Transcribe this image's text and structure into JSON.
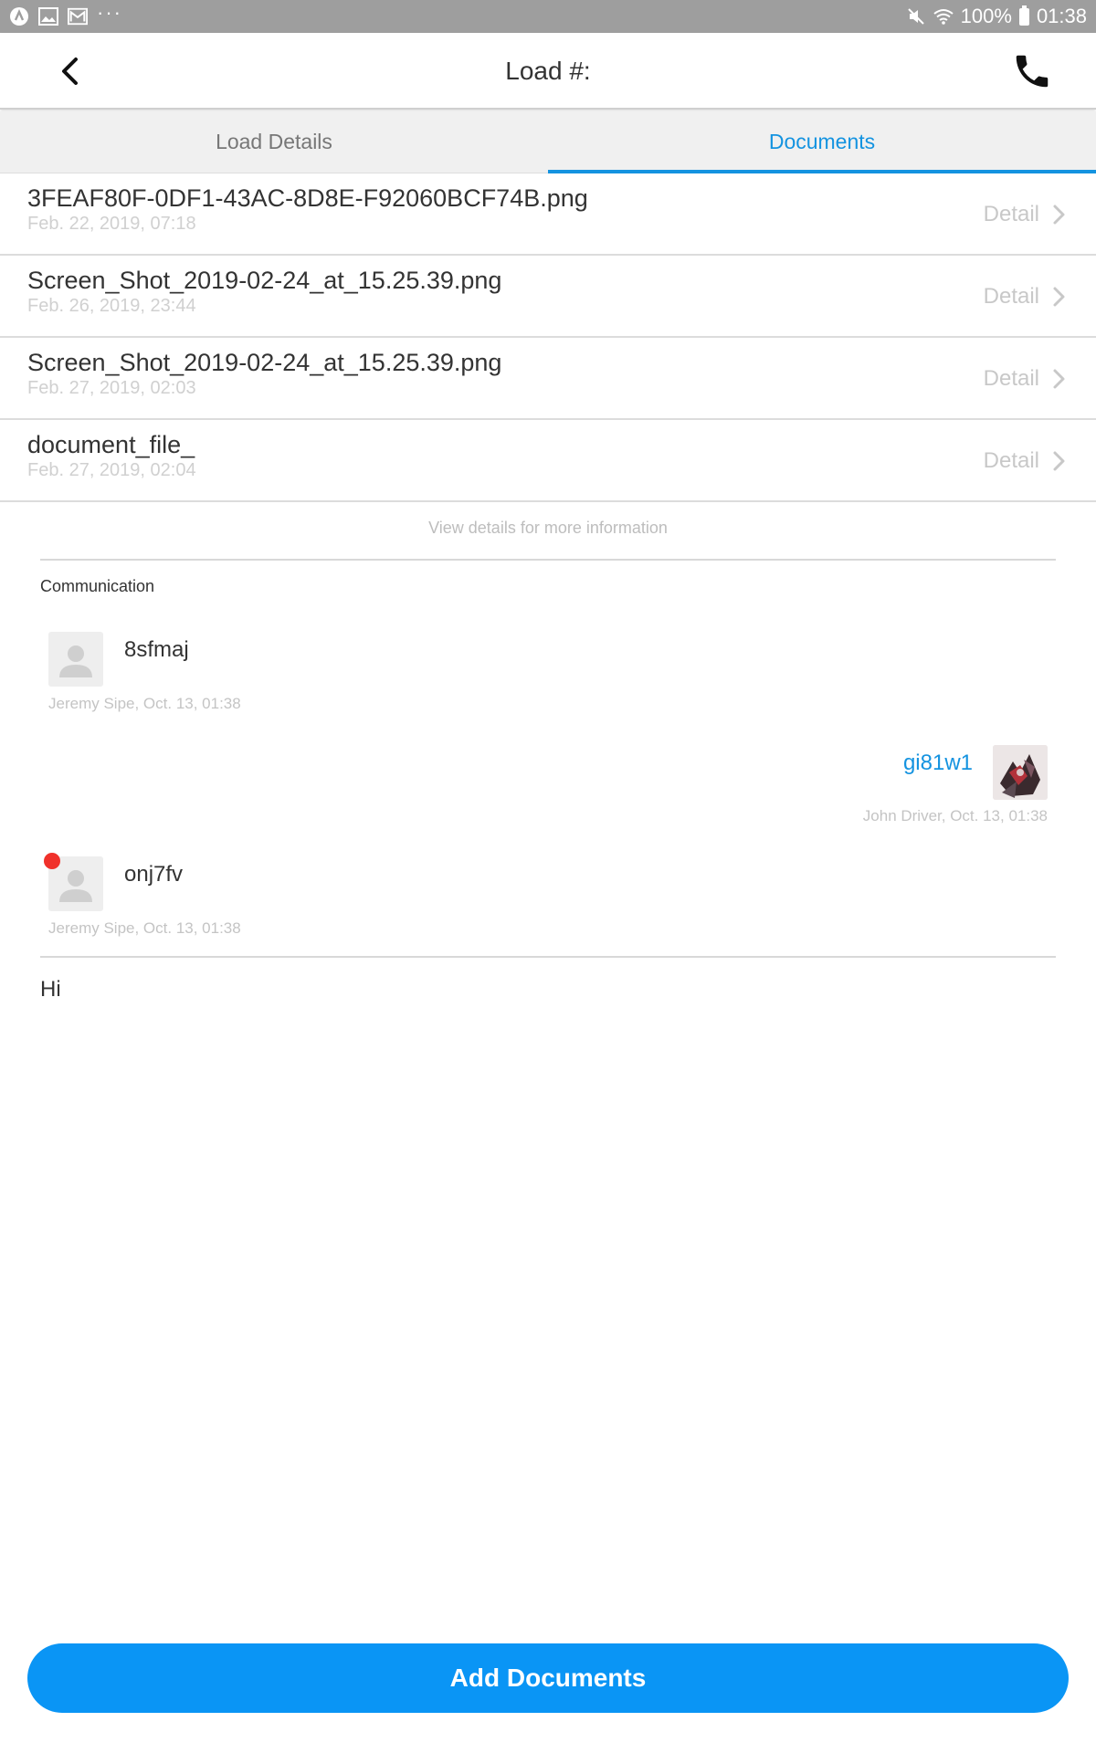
{
  "status_bar": {
    "battery": "100%",
    "time": "01:38",
    "icons": [
      "app-icon",
      "gallery-icon",
      "mail-icon",
      "more-dots-icon",
      "mute-icon",
      "wifi-icon",
      "battery-icon"
    ]
  },
  "header": {
    "title": "Load #:",
    "back_icon": "chevron-left-icon",
    "phone_icon": "phone-icon"
  },
  "tabs": [
    {
      "label": "Load Details",
      "active": false
    },
    {
      "label": "Documents",
      "active": true
    }
  ],
  "documents": [
    {
      "name": "3FEAF80F-0DF1-43AC-8D8E-F92060BCF74B.png",
      "date": "Feb. 22, 2019, 07:18",
      "action": "Detail"
    },
    {
      "name": "Screen_Shot_2019-02-24_at_15.25.39.png",
      "date": "Feb. 26, 2019, 23:44",
      "action": "Detail"
    },
    {
      "name": "Screen_Shot_2019-02-24_at_15.25.39.png",
      "date": "Feb. 27, 2019, 02:03",
      "action": "Detail"
    },
    {
      "name": "document_file_",
      "date": "Feb. 27, 2019, 02:04",
      "action": "Detail"
    }
  ],
  "info_text": "View details for more information",
  "communication": {
    "title": "Communication",
    "messages": [
      {
        "text": "8sfmaj",
        "meta": "Jeremy Sipe, Oct. 13, 01:38",
        "side": "left",
        "unread": false
      },
      {
        "text": "gi81w1",
        "meta": "John Driver, Oct. 13, 01:38",
        "side": "right",
        "unread": false
      },
      {
        "text": "onj7fv",
        "meta": "Jeremy Sipe, Oct. 13, 01:38",
        "side": "left",
        "unread": true
      }
    ],
    "input_value": "Hi"
  },
  "add_button_label": "Add Documents",
  "colors": {
    "accent": "#1493e0",
    "button": "#0a95f5",
    "unread": "#f0312b",
    "status_bar": "#9e9e9e"
  }
}
